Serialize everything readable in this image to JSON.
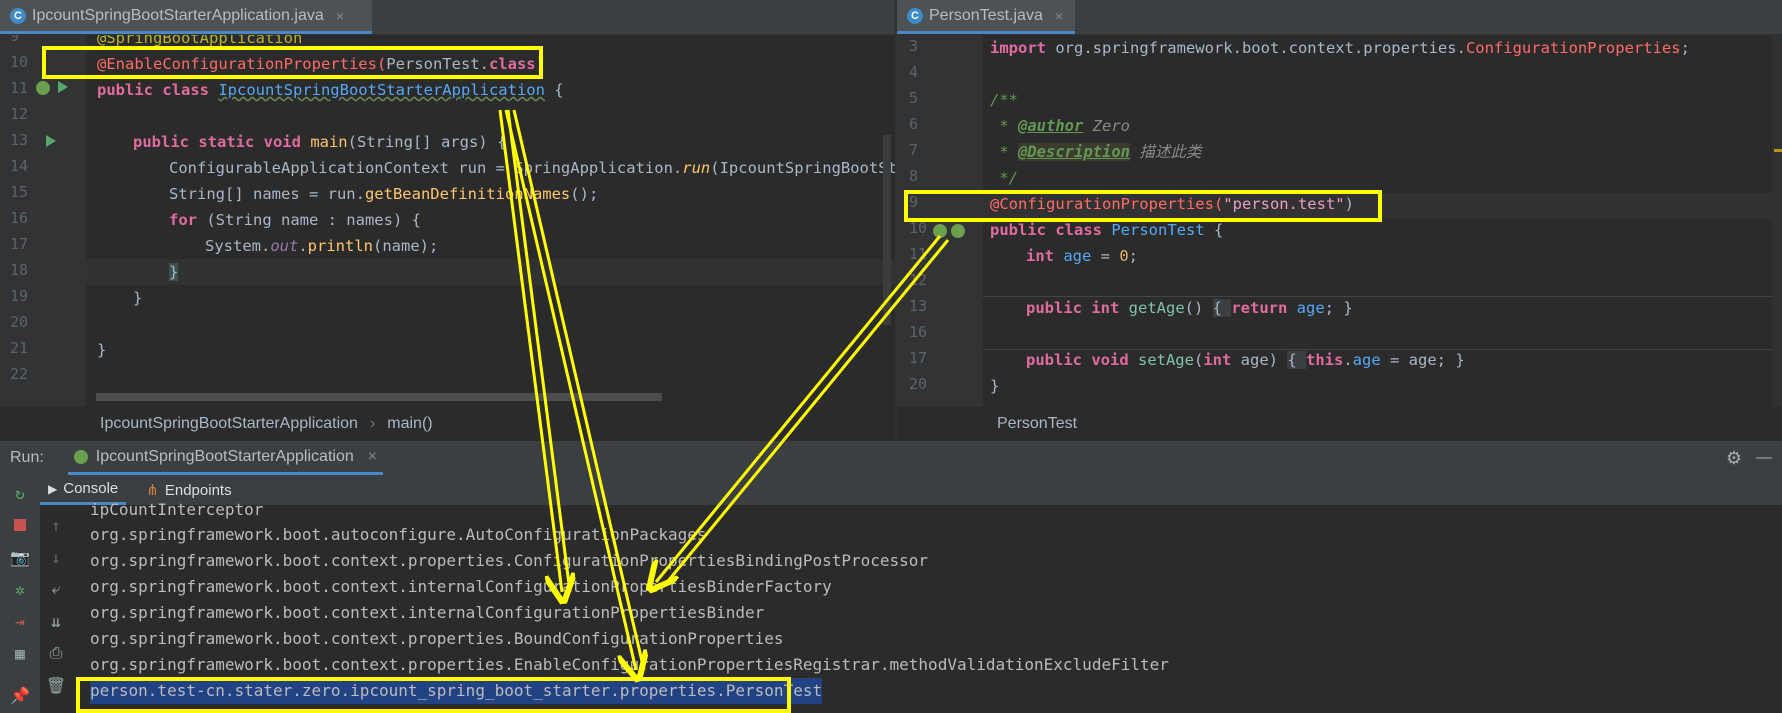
{
  "left_tab": {
    "title": "IpcountSpringBootStarterApplication.java",
    "close": "×",
    "icon_letter": "C"
  },
  "right_tab": {
    "title": "PersonTest.java",
    "close": "×",
    "icon_letter": "C"
  },
  "left_editor": {
    "line_numbers": [
      "9",
      "10",
      "11",
      "12",
      "13",
      "14",
      "15",
      "16",
      "17",
      "18",
      "19",
      "20",
      "21",
      "22"
    ],
    "lines": {
      "l9": "@SpringBootApplication",
      "l10_ann": "@EnableConfigurationProperties(",
      "l10_cls": "PersonTest",
      "l10_dot": ".",
      "l10_kw": "class",
      "l10_end": ")",
      "l11_kw": "public class ",
      "l11_name": "IpcountSpringBootStarterApplication",
      "l11_end": " {",
      "l13_kw": "public static void ",
      "l13_name": "main",
      "l13_rest": "(String[] args) {",
      "l14_a": "ConfigurableApplicationContext run = SpringApplication.",
      "l14_b": "run",
      "l14_c": "(IpcountSpringBootStart",
      "l15_a": "String[] names = run.",
      "l15_b": "getBeanDefinitionNames",
      "l15_c": "();",
      "l16_kw": "for",
      "l16_rest": " (String name : names) {",
      "l17_a": "System.",
      "l17_b": "out",
      "l17_c": ".",
      "l17_d": "println",
      "l17_e": "(name);",
      "l18": "}",
      "l19": "}",
      "l21": "}"
    },
    "breadcrumb": {
      "class": "IpcountSpringBootStarterApplication",
      "sep": "›",
      "method": "main()"
    }
  },
  "right_editor": {
    "line_numbers": [
      "3",
      "4",
      "5",
      "6",
      "7",
      "8",
      "9",
      "10",
      "11",
      "12",
      "13",
      "16",
      "17",
      "20"
    ],
    "lines": {
      "l3_kw": "import ",
      "l3_pkg": "org.springframework.boot.context.properties.",
      "l3_cls": "ConfigurationProperties",
      "l3_end": ";",
      "l5": "/**",
      "l6_star": " * ",
      "l6_tag": "@author",
      "l6_val": " Zero",
      "l7_star": " * ",
      "l7_tag": "@Description",
      "l7_val": " 描述此类",
      "l8": " */",
      "l9_ann": "@ConfigurationProperties(",
      "l9_str": "\"person.test\"",
      "l9_end": ")",
      "l10_kw": "public class ",
      "l10_name": "PersonTest",
      "l10_end": " {",
      "l11_kw": "int ",
      "l11_fld": "age",
      "l11_eq": " = ",
      "l11_num": "0",
      "l11_end": ";",
      "l13_kw": "public int ",
      "l13_name": "getAge",
      "l13_a": "() ",
      "l13_b": "{ ",
      "l13_ret": "return ",
      "l13_fld": "age",
      "l13_c": "; }",
      "l17_kw": "public void ",
      "l17_name": "setAge",
      "l17_a": "(",
      "l17_int": "int ",
      "l17_b": "age) ",
      "l17_c": "{ ",
      "l17_this": "this",
      "l17_d": ".",
      "l17_fld": "age",
      "l17_e": " = age; }",
      "l20": "}"
    },
    "breadcrumb": "PersonTest"
  },
  "run_panel": {
    "label": "Run:",
    "config": "IpcountSpringBootStarterApplication",
    "close": "×",
    "tabs": [
      "Console",
      "Endpoints"
    ]
  },
  "console_lines": [
    "ipCountInterceptor",
    "org.springframework.boot.autoconfigure.AutoConfigurationPackages",
    "org.springframework.boot.context.properties.ConfigurationPropertiesBindingPostProcessor",
    "org.springframework.boot.context.internalConfigurationPropertiesBinderFactory",
    "org.springframework.boot.context.internalConfigurationPropertiesBinder",
    "org.springframework.boot.context.properties.BoundConfigurationProperties",
    "org.springframework.boot.context.properties.EnableConfigurationPropertiesRegistrar.methodValidationExcludeFilter",
    "person.test-cn.stater.zero.ipcount_spring_boot_starter.properties.PersonTest"
  ],
  "colors": {
    "highlight": "#ffff00",
    "selection": "#214283",
    "background": "#2b2b2b"
  }
}
